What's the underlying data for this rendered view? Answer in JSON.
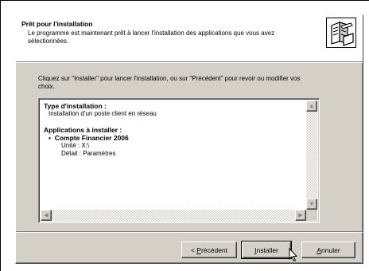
{
  "header": {
    "title": "Prêt pour l'installation",
    "description": "Le programme est maintenant prêt à lancer l'installation des applications que vous avez sélectionnées.",
    "icon": "setup-computer-icon"
  },
  "instructions": "Cliquez sur \"Installer\" pour lancer l'installation, ou sur \"Précédent\" pour revoir ou modifier vos choix.",
  "summary": {
    "install_type_heading": "Type d'installation :",
    "install_type_value": "Installation d'un poste client en réseau",
    "apps_heading": "Applications à installer :",
    "app_name": "Compte Financier 2006",
    "app_unit": "Unité : X:\\",
    "app_detail": "Détail : Paramètres"
  },
  "buttons": {
    "back_prefix": "< ",
    "back_mnemonic": "P",
    "back_rest": "récédent",
    "install_mnemonic": "I",
    "install_rest": "nstaller",
    "cancel_mnemonic": "A",
    "cancel_rest": "nnuler"
  },
  "colors": {
    "dialog_face": "#d4d0c8",
    "header_background": "#ffffff"
  }
}
